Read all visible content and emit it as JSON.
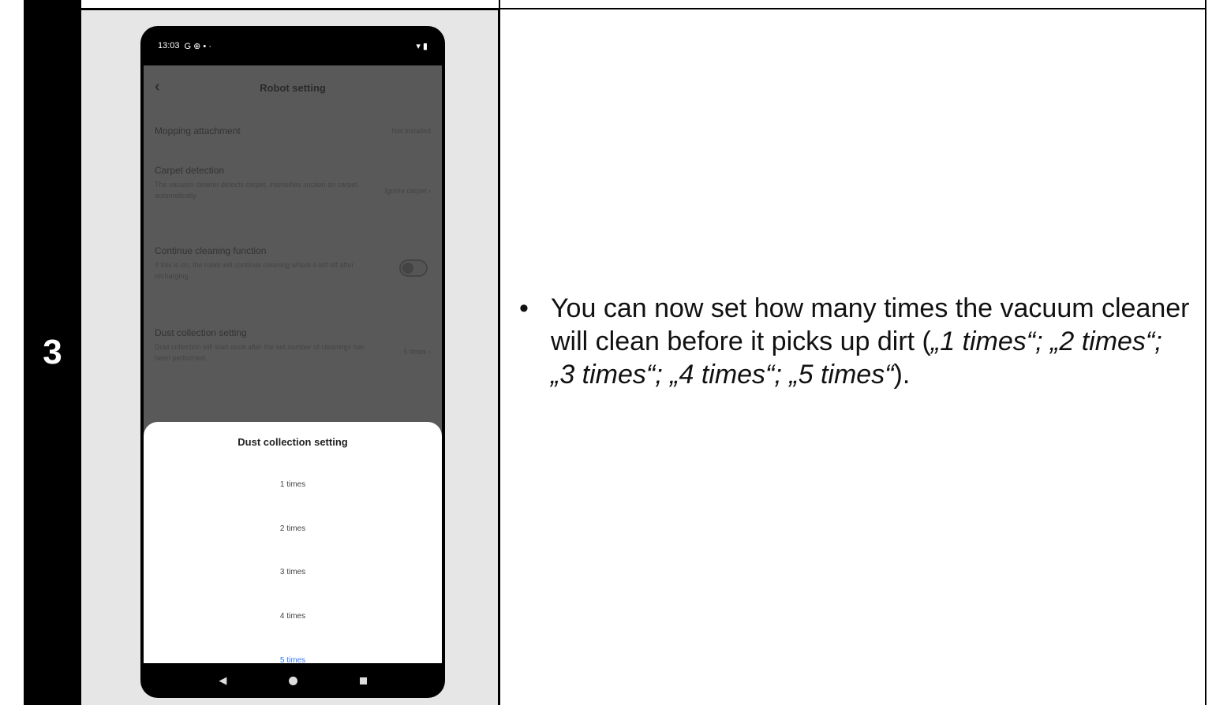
{
  "step": {
    "number": "3"
  },
  "instruction": {
    "bullet": "•",
    "lead": "You can now set how many times the vacuum cleaner will clean before it picks up dirt (",
    "opt1": "„1 times“",
    "sep1": "; ",
    "opt2": "„2 times“",
    "sep2": "; ",
    "opt3": "„3 times“",
    "sep3": "; ",
    "opt4": "„4 times“",
    "sep4": "; ",
    "opt5": "„5 times“",
    "tail": ")."
  },
  "phone": {
    "status": {
      "time": "13:03",
      "icons": "G ⊕ • ·",
      "right_icons": "▾ ▮"
    },
    "header": {
      "title": "Robot setting",
      "back_icon": "chevron-left-icon"
    },
    "settings": [
      {
        "title": "Mopping attachment",
        "value": "Not installed"
      },
      {
        "title": "Carpet detection",
        "desc": "The vacuum cleaner detects carpet, intensifies suction on carpet automatically.",
        "value": "Ignore carpet ›"
      },
      {
        "title": "Continue cleaning function",
        "desc": "If this is on, the robot will continue cleaning where it left off after recharging."
      },
      {
        "title": "Dust collection setting",
        "desc": "Dust collection will start once after the set number of cleanings has been performed.",
        "value": "5 times ›"
      }
    ],
    "sheet": {
      "title": "Dust collection setting",
      "options": [
        "1 times",
        "2 times",
        "3 times",
        "4 times",
        "5 times"
      ],
      "selected_index": 4
    },
    "nav": {
      "back": "◀",
      "home": "home-icon",
      "recent": "recent-apps-icon"
    }
  },
  "colors": {
    "accent": "#3a7bff",
    "overlay": "#595959"
  }
}
